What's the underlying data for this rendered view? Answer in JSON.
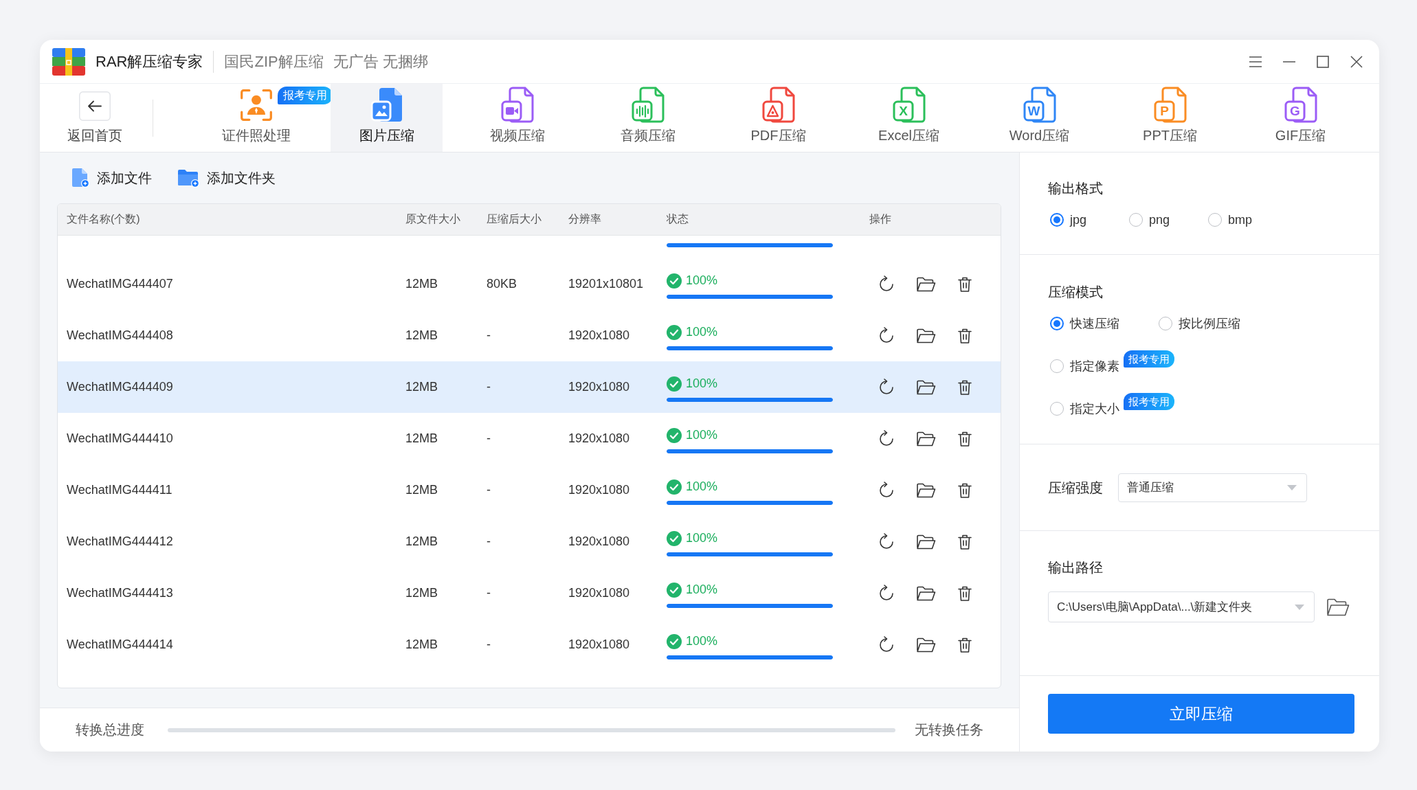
{
  "window": {
    "title": "RAR解压缩专家",
    "slogans": [
      "国民ZIP解压缩",
      "无广告 无捆绑"
    ]
  },
  "toolbar": {
    "back_label": "返回首页",
    "tabs": [
      {
        "label": "证件照处理",
        "kind": "portrait",
        "color": "#fa8c23",
        "badge": "报考专用",
        "selected": false
      },
      {
        "label": "图片压缩",
        "kind": "image",
        "color": "#3a8bfb",
        "selected": true
      },
      {
        "label": "视频压缩",
        "kind": "video",
        "color": "#9b5cf6",
        "selected": false
      },
      {
        "label": "音频压缩",
        "kind": "audio",
        "color": "#2bbf5a",
        "selected": false
      },
      {
        "label": "PDF压缩",
        "kind": "pdf",
        "color": "#f0483e",
        "selected": false
      },
      {
        "label": "Excel压缩",
        "kind": "letter",
        "letter": "X",
        "color": "#2bbf5a",
        "selected": false
      },
      {
        "label": "Word压缩",
        "kind": "letter",
        "letter": "W",
        "color": "#2f86f6",
        "selected": false
      },
      {
        "label": "PPT压缩",
        "kind": "letter",
        "letter": "P",
        "color": "#fa8c23",
        "selected": false
      },
      {
        "label": "GIF压缩",
        "kind": "letter",
        "letter": "G",
        "color": "#9b5cf6",
        "selected": false
      }
    ]
  },
  "file_actions": [
    {
      "label": "添加文件",
      "kind": "file"
    },
    {
      "label": "添加文件夹",
      "kind": "folder"
    }
  ],
  "table": {
    "columns": [
      "文件名称(个数)",
      "原文件大小",
      "压缩后大小",
      "分辨率",
      "状态",
      "操作"
    ],
    "partial_row": {
      "level": 1
    },
    "rows": [
      {
        "name": "WechatIMG444407",
        "original_size": "12MB",
        "compressed_size": "80KB",
        "resolution": "19201x10801",
        "percent": "100%",
        "done": true,
        "level": 1,
        "selected": false
      },
      {
        "name": "WechatIMG444408",
        "original_size": "12MB",
        "compressed_size": "-",
        "resolution": "1920x1080",
        "percent": "100%",
        "done": true,
        "level": 1,
        "selected": false
      },
      {
        "name": "WechatIMG444409",
        "original_size": "12MB",
        "compressed_size": "-",
        "resolution": "1920x1080",
        "percent": "100%",
        "done": true,
        "level": 1,
        "selected": true
      },
      {
        "name": "WechatIMG444410",
        "original_size": "12MB",
        "compressed_size": "-",
        "resolution": "1920x1080",
        "percent": "100%",
        "done": true,
        "level": 1,
        "selected": false
      },
      {
        "name": "WechatIMG444411",
        "original_size": "12MB",
        "compressed_size": "-",
        "resolution": "1920x1080",
        "percent": "100%",
        "done": true,
        "level": 1,
        "selected": false
      },
      {
        "name": "WechatIMG444412",
        "original_size": "12MB",
        "compressed_size": "-",
        "resolution": "1920x1080",
        "percent": "100%",
        "done": true,
        "level": 1,
        "selected": false
      },
      {
        "name": "WechatIMG444413",
        "original_size": "12MB",
        "compressed_size": "-",
        "resolution": "1920x1080",
        "percent": "100%",
        "done": true,
        "level": 1,
        "selected": false
      },
      {
        "name": "WechatIMG444414",
        "original_size": "12MB",
        "compressed_size": "-",
        "resolution": "1920x1080",
        "percent": "100%",
        "done": true,
        "level": 1,
        "selected": false
      }
    ]
  },
  "overall_progress": {
    "label": "转换总进度",
    "level": 0,
    "status": "无转换任务"
  },
  "settings": {
    "output_format": {
      "title": "输出格式",
      "options": [
        {
          "label": "jpg",
          "selected": true
        },
        {
          "label": "png",
          "selected": false
        },
        {
          "label": "bmp",
          "selected": false
        }
      ]
    },
    "compress_mode": {
      "title": "压缩模式",
      "options": [
        {
          "label": "快速压缩",
          "selected": true
        },
        {
          "label": "按比例压缩",
          "selected": false
        },
        {
          "label": "指定像素",
          "selected": false,
          "badge": "报考专用"
        },
        {
          "label": "指定大小",
          "selected": false,
          "badge": "报考专用"
        }
      ]
    },
    "strength": {
      "label": "压缩强度",
      "value": "普通压缩"
    },
    "output_path": {
      "title": "输出路径",
      "value": "C:\\Users\\电脑\\AppData\\...\\新建文件夹"
    }
  },
  "compress_button": "立即压缩"
}
